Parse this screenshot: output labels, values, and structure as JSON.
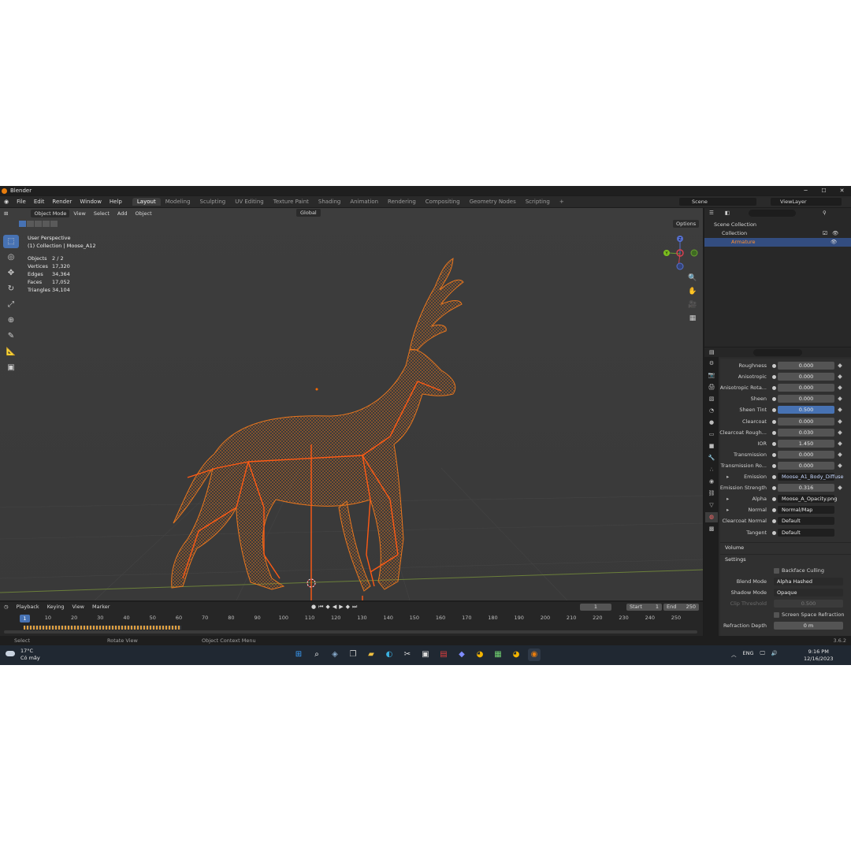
{
  "window": {
    "title": "Blender",
    "minimize": "─",
    "maximize": "☐",
    "close": "✕"
  },
  "menu": {
    "items": [
      "File",
      "Edit",
      "Render",
      "Window",
      "Help"
    ],
    "workspaces": [
      "Layout",
      "Modeling",
      "Sculpting",
      "UV Editing",
      "Texture Paint",
      "Shading",
      "Animation",
      "Rendering",
      "Compositing",
      "Geometry Nodes",
      "Scripting"
    ],
    "active_workspace": "Layout",
    "add_tab": "+",
    "scene": "Scene",
    "view_layer": "ViewLayer"
  },
  "viewport": {
    "header": {
      "mode": "Object Mode",
      "view": "View",
      "select": "Select",
      "add": "Add",
      "object": "Object",
      "orientation": "Global",
      "options": "Options"
    },
    "info": {
      "perspective": "User Perspective",
      "collection": "(1) Collection | Moose_A12"
    },
    "stats": [
      {
        "label": "Objects",
        "value": "2 / 2"
      },
      {
        "label": "Vertices",
        "value": "17,320"
      },
      {
        "label": "Edges",
        "value": "34,364"
      },
      {
        "label": "Faces",
        "value": "17,052"
      },
      {
        "label": "Triangles",
        "value": "34,104"
      }
    ],
    "gizmo": {
      "z": "Z",
      "y": "Y"
    },
    "colors": {
      "wire": "#e8761e",
      "bone": "#ff5a14",
      "grid": "#4a4a4a"
    }
  },
  "timeline": {
    "menus": [
      "Playback",
      "Keying",
      "View",
      "Marker"
    ],
    "current_frame": "1",
    "start_label": "Start",
    "start": "1",
    "end_label": "End",
    "end": "250",
    "ruler": [
      "1",
      "10",
      "20",
      "30",
      "40",
      "50",
      "60",
      "70",
      "80",
      "90",
      "100",
      "110",
      "120",
      "130",
      "140",
      "150",
      "160",
      "170",
      "180",
      "190",
      "200",
      "210",
      "220",
      "230",
      "240",
      "250"
    ]
  },
  "statusbar": {
    "select": "Select",
    "rotate": "Rotate View",
    "context": "Object Context Menu",
    "version": "3.6.2"
  },
  "outliner": {
    "scene_collection": "Scene Collection",
    "collection": "Collection",
    "armature": "Armature"
  },
  "properties": {
    "rows": [
      {
        "label": "Roughness",
        "value": "0.000"
      },
      {
        "label": "Anisotropic",
        "value": "0.000"
      },
      {
        "label": "Anisotropic Rota...",
        "value": "0.000"
      },
      {
        "label": "Sheen",
        "value": "0.000"
      },
      {
        "label": "Sheen Tint",
        "value": "0.500"
      },
      {
        "label": "Clearcoat",
        "value": "0.000"
      },
      {
        "label": "Clearcoat Rough...",
        "value": "0.030"
      },
      {
        "label": "IOR",
        "value": "1.450"
      },
      {
        "label": "Transmission",
        "value": "0.000"
      },
      {
        "label": "Transmission Ro...",
        "value": "0.000"
      },
      {
        "label": "Emission",
        "value": "Moose_A1_Body_Diffuse"
      },
      {
        "label": "Emission Strength",
        "value": "0.316"
      },
      {
        "label": "Alpha",
        "value": "Moose_A_Opacity.png"
      },
      {
        "label": "Normal",
        "value": "Normal/Map"
      },
      {
        "label": "Clearcoat Normal",
        "value": "Default"
      },
      {
        "label": "Tangent",
        "value": "Default"
      }
    ],
    "volume": "Volume",
    "settings": "Settings",
    "backface": "Backface Culling",
    "blend_mode_label": "Blend Mode",
    "blend_mode": "Alpha Hashed",
    "shadow_mode_label": "Shadow Mode",
    "shadow_mode": "Opaque",
    "clip_label": "Clip Threshold",
    "clip": "0.500",
    "ssr": "Screen Space Refraction",
    "refraction_label": "Refraction Depth",
    "refraction": "0 m"
  },
  "taskbar": {
    "temp": "17°C",
    "weather": "Có mây",
    "lang": "ENG",
    "time": "9:16 PM",
    "date": "12/16/2023"
  }
}
